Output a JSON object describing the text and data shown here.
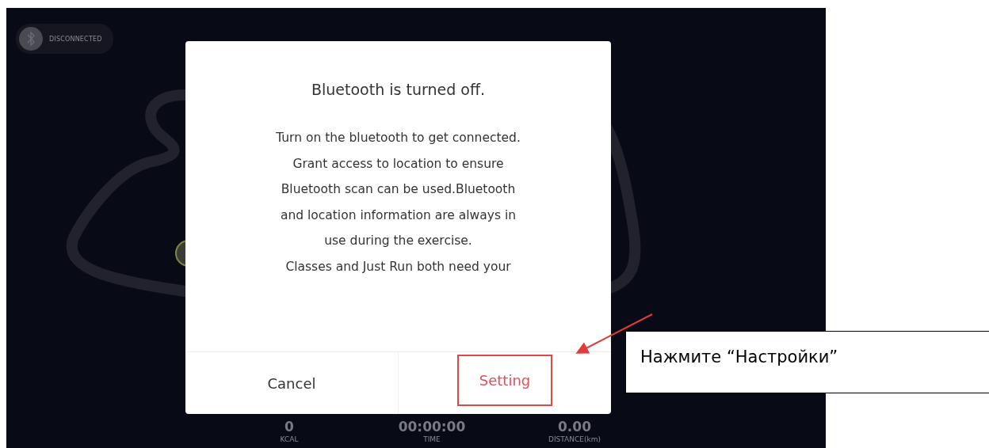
{
  "status_pill": {
    "label": "DISCONNECTED"
  },
  "stats": [
    {
      "value": "0",
      "label": "KCAL"
    },
    {
      "value": "00:00:00",
      "label": "TIME"
    },
    {
      "value": "0.00",
      "label": "DISTANCE(km)"
    }
  ],
  "dialog": {
    "title": "Bluetooth is turned off.",
    "message_lines": [
      "Turn on the bluetooth to get connected.",
      "Grant access to location to ensure",
      "Bluetooth scan can be used.Bluetooth",
      "and location information are always in",
      "use during the exercise.",
      "Classes and Just Run both need your"
    ],
    "buttons": [
      {
        "label": "Cancel",
        "kind": "cancel"
      },
      {
        "label": "Setting",
        "kind": "confirm",
        "highlighted": true
      }
    ]
  },
  "callout": {
    "text": "Нажмите “Настройки”"
  }
}
